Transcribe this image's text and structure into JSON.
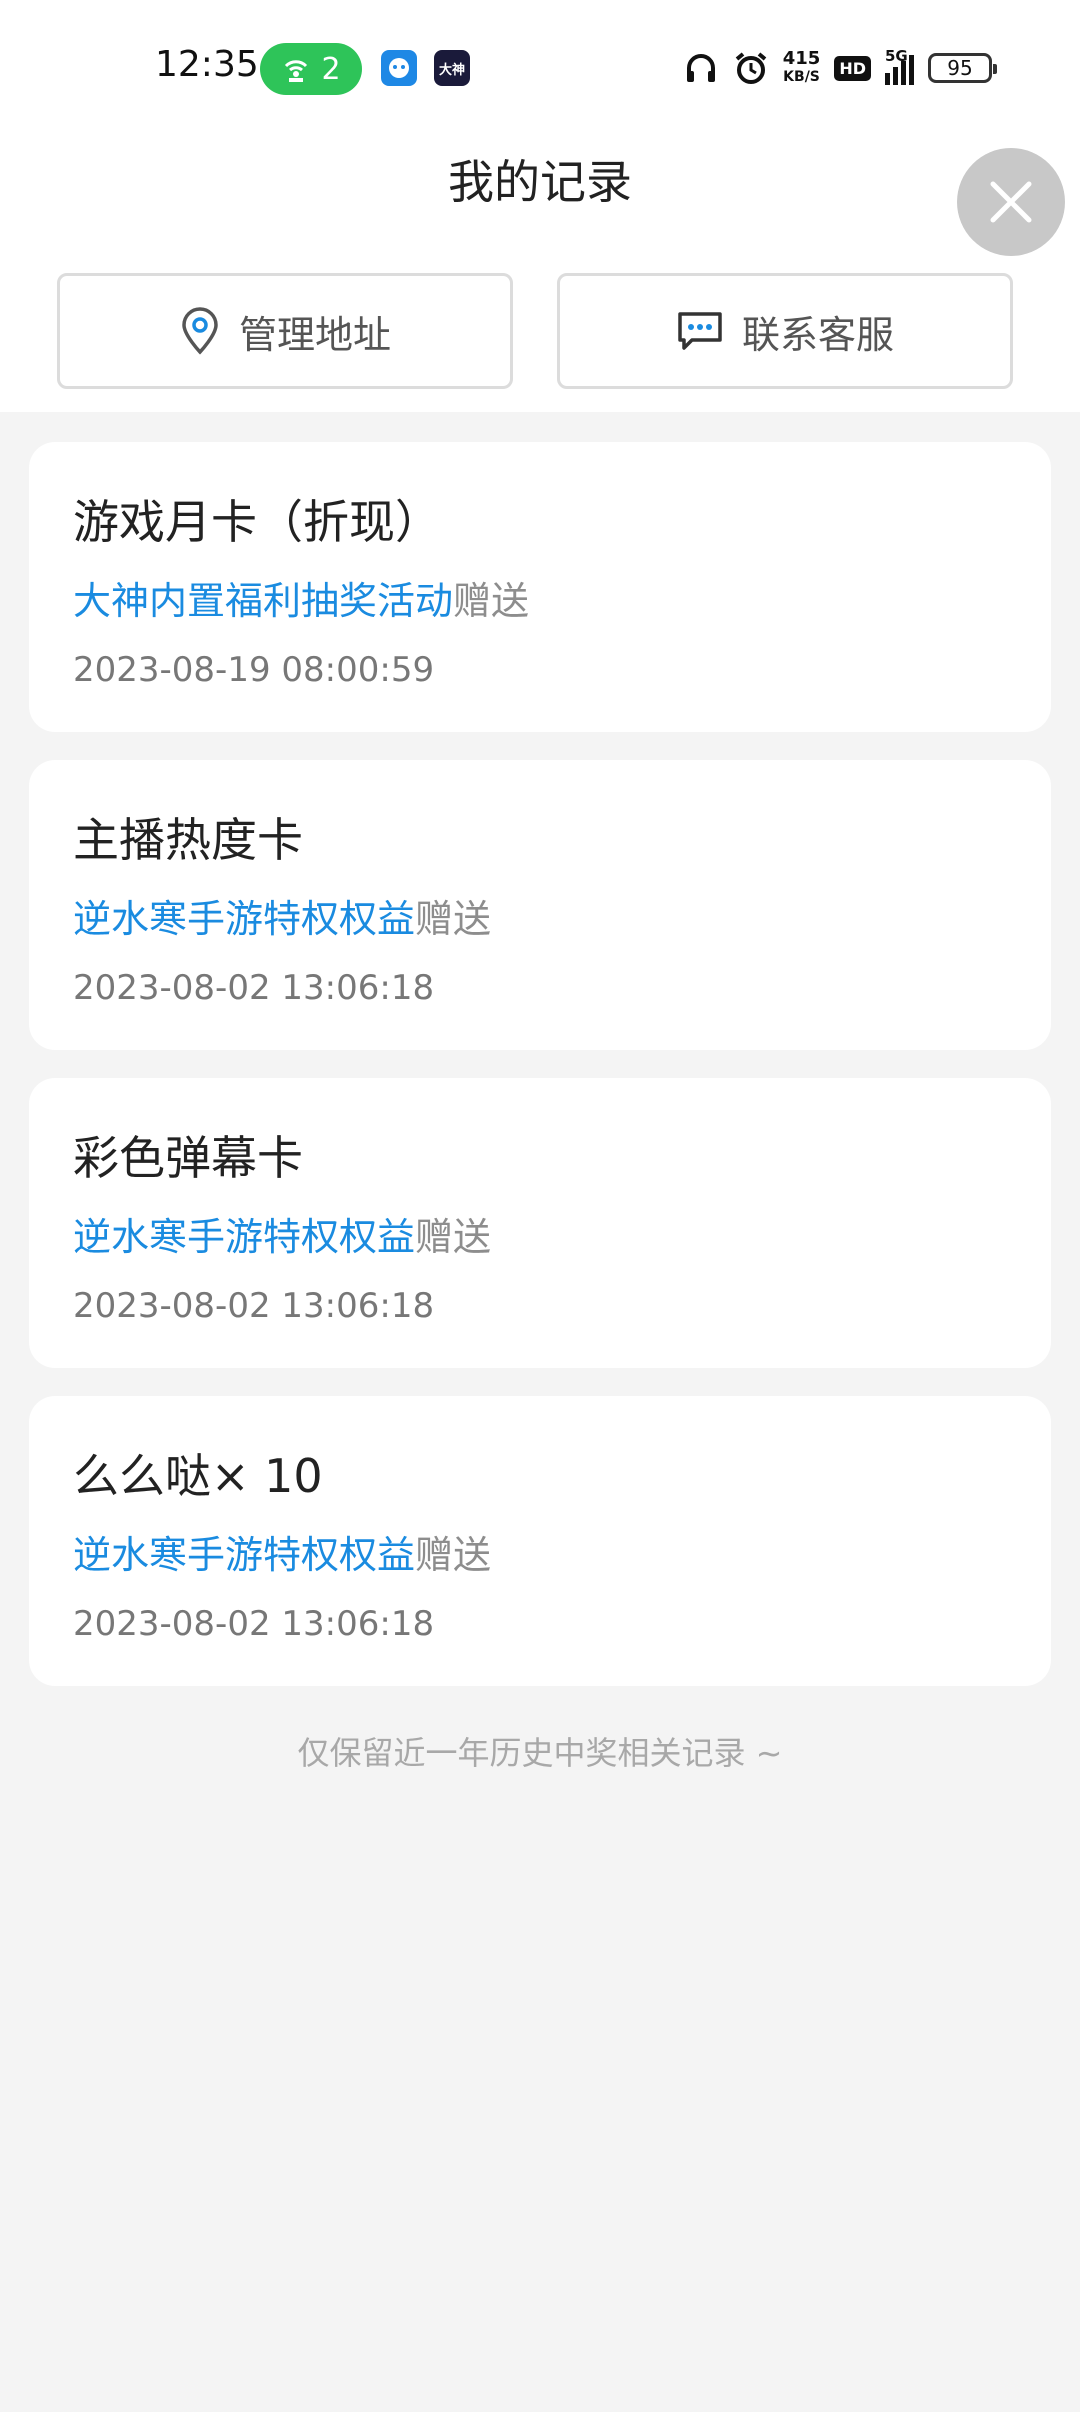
{
  "status_bar": {
    "time": "12:35",
    "hotspot_count": "2",
    "app2_label": "大神",
    "net_speed": "415",
    "net_unit": "KB/S",
    "hd": "HD",
    "network": "5G",
    "battery": "95"
  },
  "header": {
    "title": "我的记录",
    "manage_address": "管理地址",
    "contact_service": "联系客服"
  },
  "records": [
    {
      "title": "游戏月卡（折现）",
      "source": "大神内置福利抽奖活动",
      "gift": "赠送",
      "date": "2023-08-19 08:00:59"
    },
    {
      "title": "主播热度卡",
      "source": "逆水寒手游特权权益",
      "gift": "赠送",
      "date": "2023-08-02 13:06:18"
    },
    {
      "title": "彩色弹幕卡",
      "source": "逆水寒手游特权权益",
      "gift": "赠送",
      "date": "2023-08-02 13:06:18"
    },
    {
      "title": "么么哒× 10",
      "source": "逆水寒手游特权权益",
      "gift": "赠送",
      "date": "2023-08-02 13:06:18"
    }
  ],
  "footer_note": "仅保留近一年历史中奖相关记录 ~",
  "colors": {
    "link": "#1a8be0",
    "hotspot": "#2ec459",
    "background": "#f4f4f4"
  }
}
